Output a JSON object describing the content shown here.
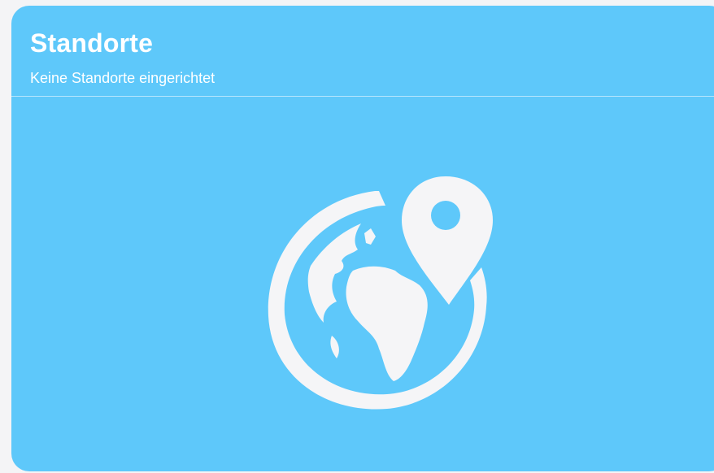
{
  "card": {
    "title": "Standorte",
    "subtitle": "Keine Standorte eingerichtet",
    "illustration_icon": "globe-with-location-pin-icon",
    "background_color": "#5ec8fa",
    "icon_color": "#f5f5f7"
  }
}
